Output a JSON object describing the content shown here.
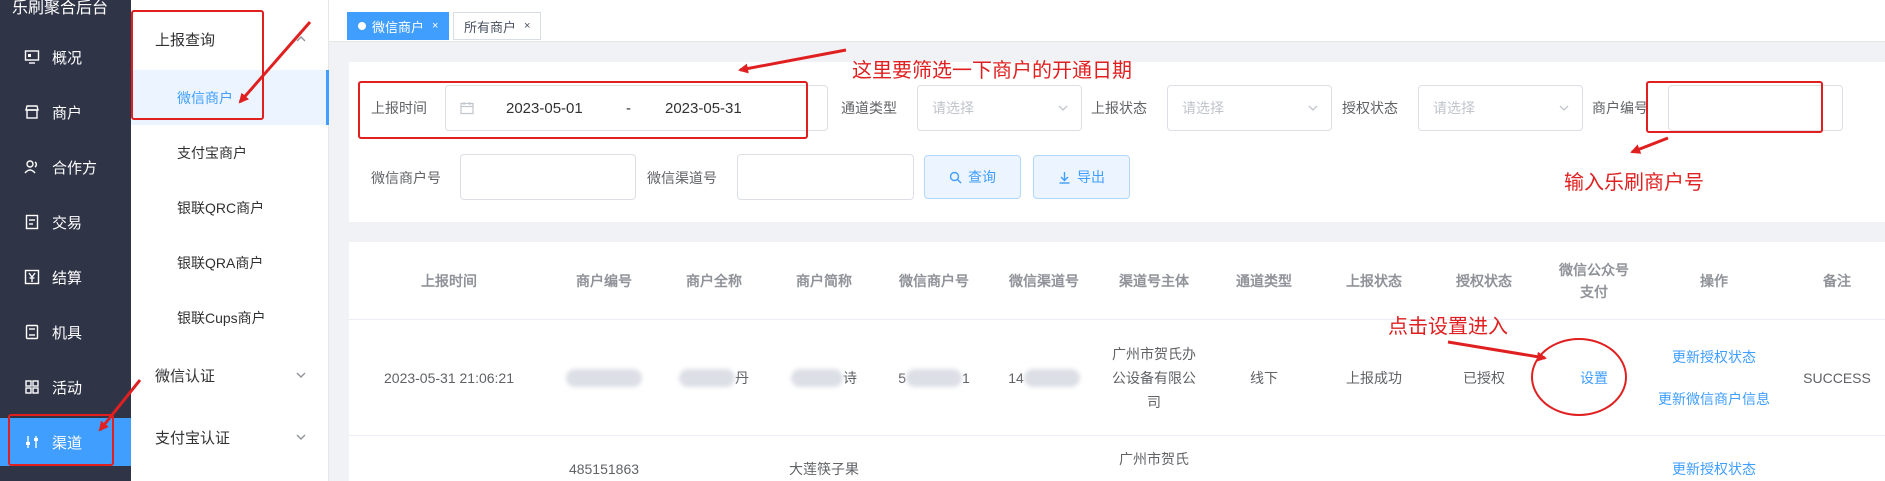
{
  "app": {
    "title": "乐刷聚合后台"
  },
  "sidebar": {
    "items": [
      {
        "label": "概况",
        "icon": "monitor-icon"
      },
      {
        "label": "商户",
        "icon": "store-icon"
      },
      {
        "label": "合作方",
        "icon": "users-icon"
      },
      {
        "label": "交易",
        "icon": "document-icon"
      },
      {
        "label": "结算",
        "icon": "yen-icon"
      },
      {
        "label": "机具",
        "icon": "device-icon"
      },
      {
        "label": "活动",
        "icon": "grid-icon"
      },
      {
        "label": "渠道",
        "icon": "sliders-icon",
        "active": true
      }
    ]
  },
  "submenu": {
    "groups": [
      {
        "label": "上报查询"
      },
      {
        "label": "微信认证"
      },
      {
        "label": "支付宝认证"
      }
    ],
    "items": [
      {
        "label": "微信商户",
        "active": true
      },
      {
        "label": "支付宝商户"
      },
      {
        "label": "银联QRC商户"
      },
      {
        "label": "银联QRA商户"
      },
      {
        "label": "银联Cups商户"
      }
    ]
  },
  "tabs": [
    {
      "label": "微信商户",
      "close": "×",
      "active": true
    },
    {
      "label": "所有商户",
      "close": "×"
    }
  ],
  "filters": {
    "report_time_label": "上报时间",
    "date_start": "2023-05-01",
    "date_sep": "-",
    "date_end": "2023-05-31",
    "channel_type_label": "通道类型",
    "channel_type_placeholder": "请选择",
    "report_status_label": "上报状态",
    "report_status_placeholder": "请选择",
    "auth_status_label": "授权状态",
    "auth_status_placeholder": "请选择",
    "merchant_no_label": "商户编号",
    "wechat_merchant_label": "微信商户号",
    "wechat_channel_label": "微信渠道号",
    "search_button": "查询",
    "export_button": "导出"
  },
  "table": {
    "columns": [
      "上报时间",
      "商户编号",
      "商户全称",
      "商户简称",
      "微信商户号",
      "微信渠道号",
      "渠道号主体",
      "通道类型",
      "上报状态",
      "授权状态",
      "微信公众号支付",
      "操作",
      "备注"
    ],
    "rows": [
      {
        "report_time": "2023-05-31 21:06:21",
        "merchant_full_tail": "丹",
        "merchant_short_tail": "诗",
        "wechat_merchant_head": "5",
        "wechat_merchant_tail": "1",
        "wechat_channel_head": "14",
        "channel_entity": "广州市贺氏办公设备有限公司",
        "channel_type": "线下",
        "report_status": "上报成功",
        "auth_status": "已授权",
        "setting": "设置",
        "action_update_auth": "更新授权状态",
        "action_update_info": "更新微信商户信息",
        "remark": "SUCCESS"
      },
      {
        "merchant_no": "485151863",
        "merchant_full": "大莲筷子果",
        "channel_entity": "广州市贺氏",
        "action_update_auth": "更新授权状态"
      }
    ]
  },
  "annotations": {
    "date_note": "这里要筛选一下商户的开通日期",
    "merchant_no_note": "输入乐刷商户号",
    "setting_note": "点击设置进入"
  },
  "colors": {
    "primary": "#409eff",
    "sidebar_bg": "#2f3447",
    "annotation": "#e02020"
  }
}
